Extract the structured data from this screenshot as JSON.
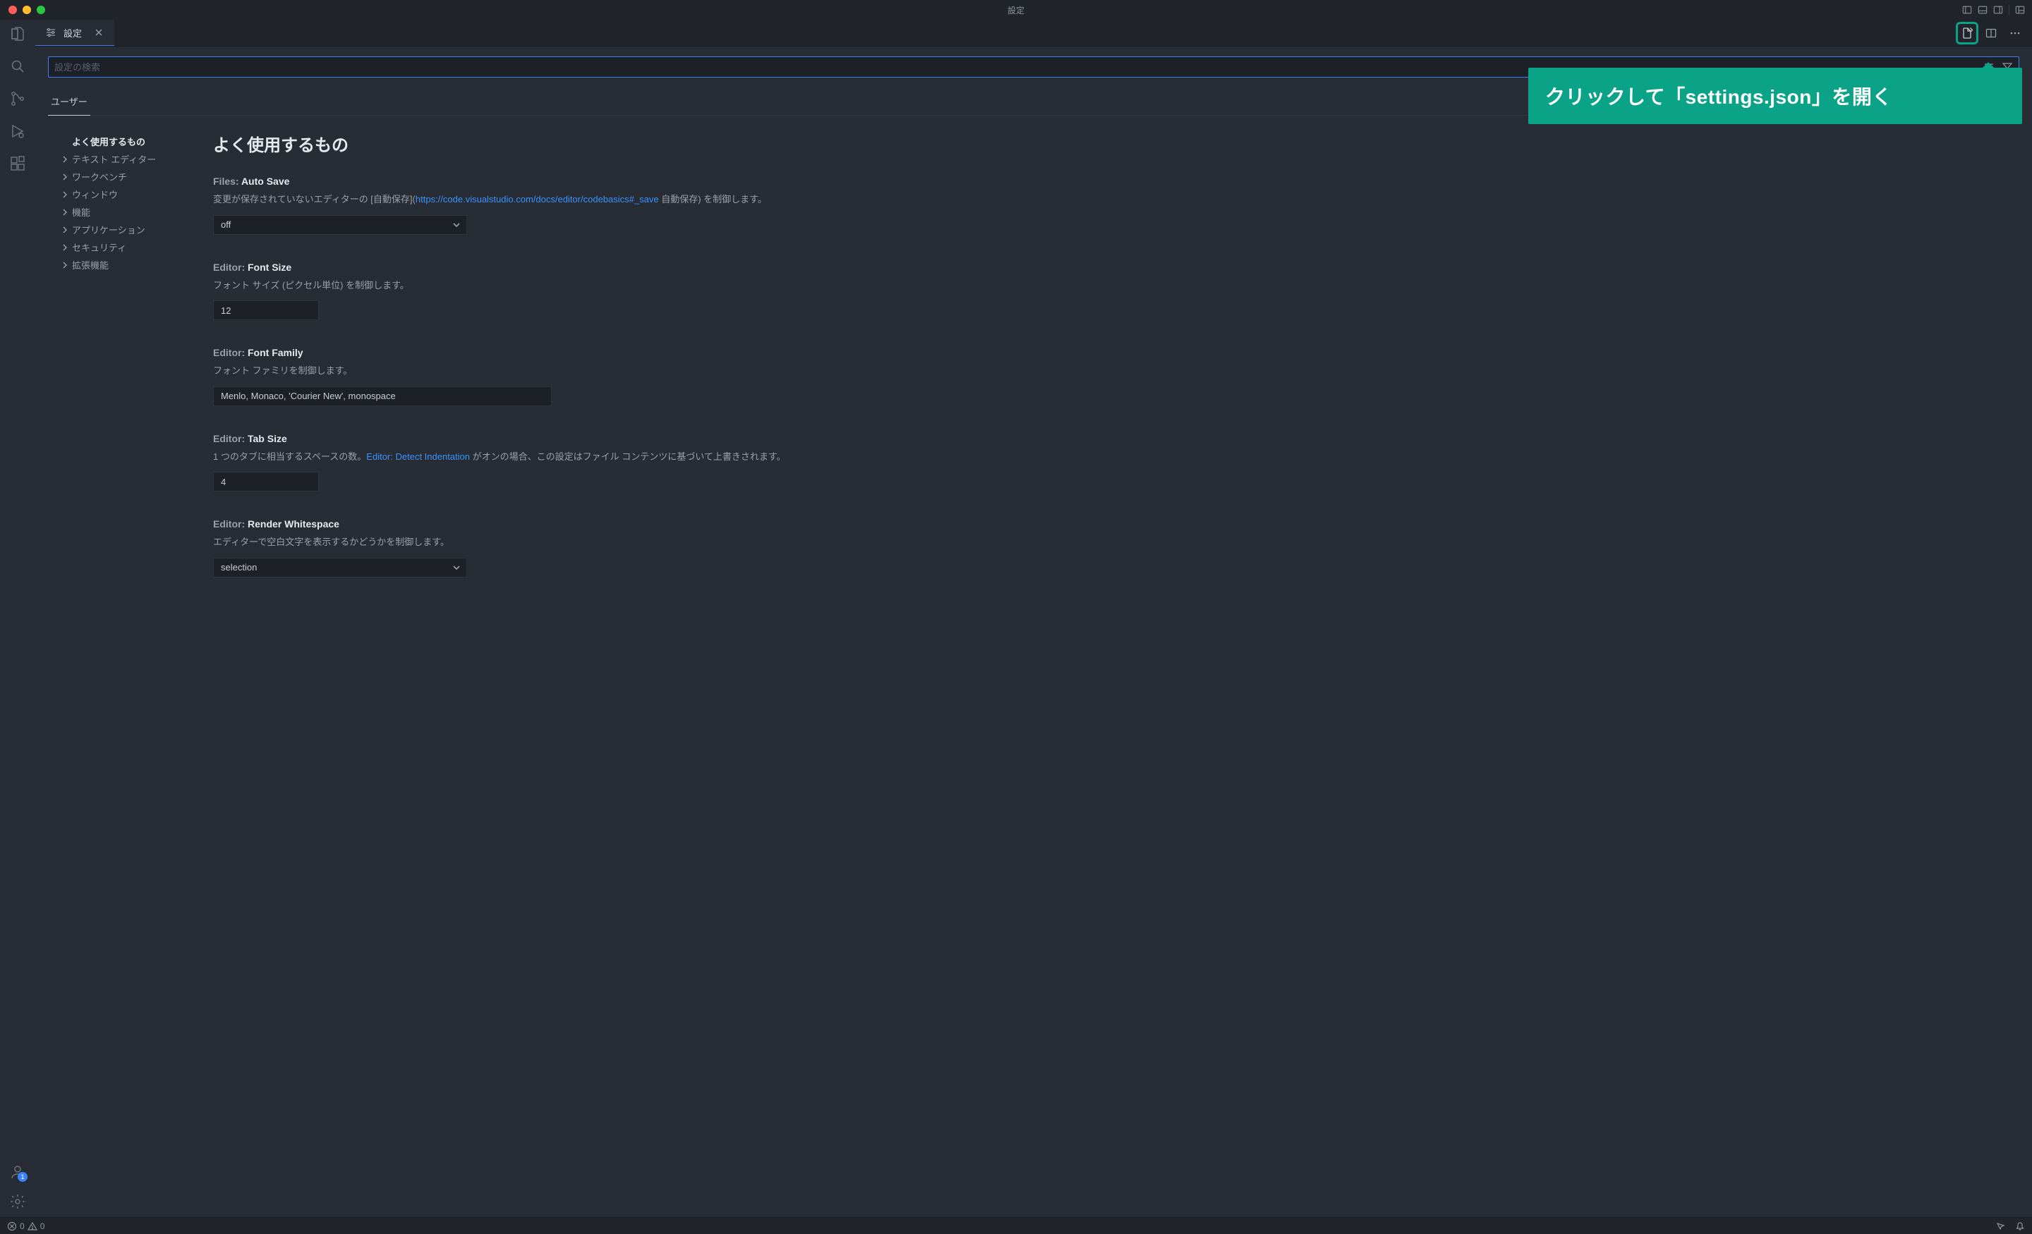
{
  "window": {
    "title": "設定"
  },
  "tab": {
    "label": "設定"
  },
  "search": {
    "placeholder": "設定の検索"
  },
  "scope": {
    "user": "ユーザー"
  },
  "callout": {
    "text": "クリックして「settings.json」を開く"
  },
  "tree": {
    "frequentlyUsed": "よく使用するもの",
    "textEditor": "テキスト エディター",
    "workbench": "ワークベンチ",
    "window": "ウィンドウ",
    "features": "機能",
    "application": "アプリケーション",
    "security": "セキュリティ",
    "extensions": "拡張機能"
  },
  "content": {
    "heading": "よく使用するもの",
    "filesAutoSave": {
      "titlePrefix": "Files: ",
      "titleKey": "Auto Save",
      "descPrefix": "変更が保存されていないエディターの [自動保存](",
      "link": "https://code.visualstudio.com/docs/editor/codebasics#_save",
      "descSuffix": " 自動保存) を制御します。",
      "value": "off"
    },
    "fontSize": {
      "titlePrefix": "Editor: ",
      "titleKey": "Font Size",
      "desc": "フォント サイズ (ピクセル単位) を制御します。",
      "value": "12"
    },
    "fontFamily": {
      "titlePrefix": "Editor: ",
      "titleKey": "Font Family",
      "desc": "フォント ファミリを制御します。",
      "value": "Menlo, Monaco, 'Courier New', monospace"
    },
    "tabSize": {
      "titlePrefix": "Editor: ",
      "titleKey": "Tab Size",
      "descPrefix": "1 つのタブに相当するスペースの数。",
      "link": "Editor: Detect Indentation",
      "descSuffix": " がオンの場合、この設定はファイル コンテンツに基づいて上書きされます。",
      "value": "4"
    },
    "renderWhitespace": {
      "titlePrefix": "Editor: ",
      "titleKey": "Render Whitespace",
      "desc": "エディターで空白文字を表示するかどうかを制御します。",
      "value": "selection"
    }
  },
  "status": {
    "errors": "0",
    "warnings": "0"
  },
  "accounts": {
    "badge": "1"
  }
}
